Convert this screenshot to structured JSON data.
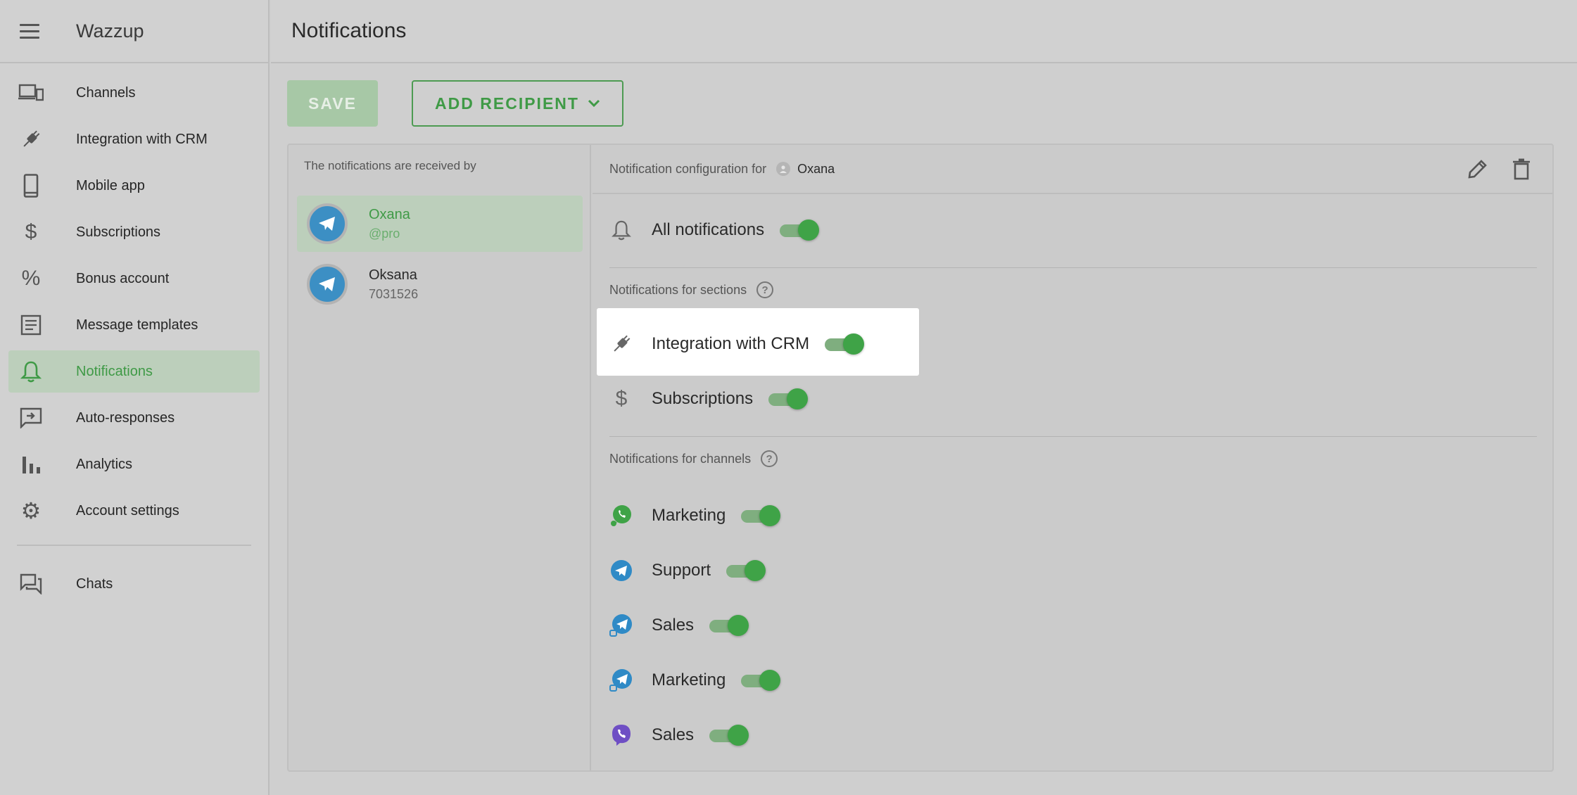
{
  "app": {
    "title": "Wazzup"
  },
  "sidebar": {
    "items": [
      {
        "label": "Channels",
        "icon": "devices-icon"
      },
      {
        "label": "Integration with CRM",
        "icon": "plug-icon"
      },
      {
        "label": "Mobile app",
        "icon": "phone-icon"
      },
      {
        "label": "Subscriptions",
        "icon": "dollar-icon"
      },
      {
        "label": "Bonus account",
        "icon": "percent-icon"
      },
      {
        "label": "Message templates",
        "icon": "document-icon"
      },
      {
        "label": "Notifications",
        "icon": "bell-icon",
        "active": true
      },
      {
        "label": "Auto-responses",
        "icon": "auto-reply-icon"
      },
      {
        "label": "Analytics",
        "icon": "bar-chart-icon"
      },
      {
        "label": "Account settings",
        "icon": "gear-icon"
      }
    ],
    "chats_label": "Chats"
  },
  "header": {
    "title": "Notifications"
  },
  "toolbar": {
    "save_label": "SAVE",
    "add_label": "ADD RECIPIENT"
  },
  "recipients": {
    "heading": "The notifications are received by",
    "items": [
      {
        "name": "Oxana",
        "sub": "@pro",
        "active": true
      },
      {
        "name": "Oksana",
        "sub": "7031526"
      }
    ]
  },
  "config": {
    "heading": "Notification configuration for",
    "user": "Oxana",
    "all_label": "All notifications",
    "sections_heading": "Notifications for sections",
    "sections": [
      {
        "label": "Integration with CRM",
        "icon": "plug-icon",
        "on": true,
        "highlighted": true
      },
      {
        "label": "Subscriptions",
        "icon": "dollar-icon",
        "on": true
      }
    ],
    "channels_heading": "Notifications for channels",
    "channels": [
      {
        "label": "Marketing",
        "icon": "whatsapp-icon",
        "on": true
      },
      {
        "label": "Support",
        "icon": "telegram-icon",
        "on": true
      },
      {
        "label": "Sales",
        "icon": "telegram-personal-icon",
        "on": true
      },
      {
        "label": "Marketing",
        "icon": "telegram-personal-icon",
        "on": true
      },
      {
        "label": "Sales",
        "icon": "viber-icon",
        "on": true
      }
    ]
  },
  "colors": {
    "accent": "#3fa347",
    "telegram": "#2f8ac6",
    "whatsapp": "#3fa347",
    "viber": "#6f4fc4"
  }
}
